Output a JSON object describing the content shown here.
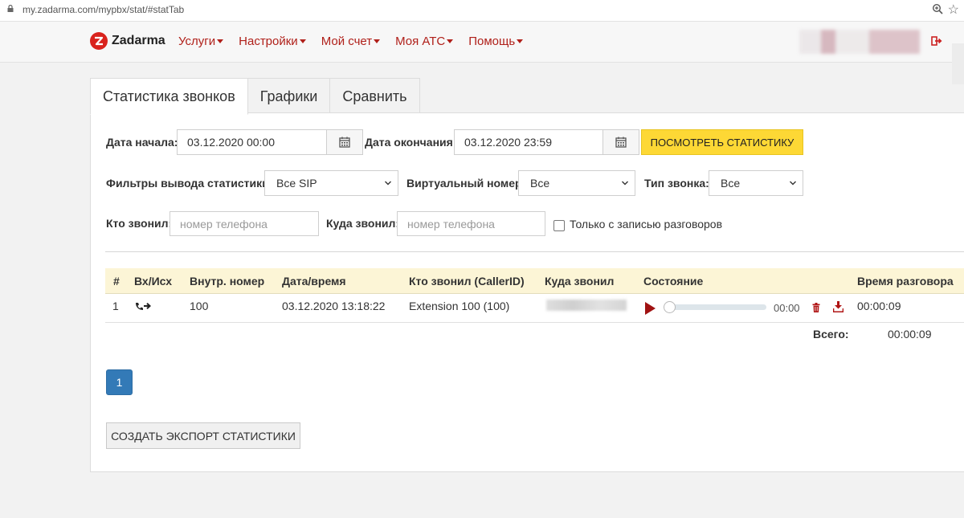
{
  "browser": {
    "url": "my.zadarma.com/mypbx/stat/#statTab"
  },
  "header": {
    "brand": "Zadarma",
    "menu": [
      {
        "label": "Услуги"
      },
      {
        "label": "Настройки"
      },
      {
        "label": "Мой счет"
      },
      {
        "label": "Моя АТС"
      },
      {
        "label": "Помощь"
      }
    ],
    "colors": {
      "brand_red": "#d9231d",
      "menu_red": "#b0201a"
    }
  },
  "tabs": [
    {
      "label": "Статистика звонков",
      "active": true
    },
    {
      "label": "Графики",
      "active": false
    },
    {
      "label": "Сравнить",
      "active": false
    }
  ],
  "filters": {
    "start_label": "Дата начала:",
    "start_value": "03.12.2020 00:00",
    "end_label": "Дата окончания:",
    "end_value": "03.12.2020 23:59",
    "submit_label": "Посмотреть статистику",
    "output_filter_label": "Фильтры вывода статистики:",
    "output_filter_value": "Все SIP",
    "virtual_number_label": "Виртуальный номер:",
    "virtual_number_value": "Все",
    "call_type_label": "Тип звонка:",
    "call_type_value": "Все",
    "caller_label": "Кто звонил:",
    "caller_placeholder": "номер телефона",
    "callee_label": "Куда звонил:",
    "callee_placeholder": "номер телефона",
    "recorded_only_label": "Только с записью разговоров",
    "recorded_only_checked": false
  },
  "table": {
    "columns": [
      "#",
      "Вх/Исх",
      "Внутр. номер",
      "Дата/время",
      "Кто звонил (CallerID)",
      "Куда звонил",
      "Состояние",
      "Время разговора"
    ],
    "rows": [
      {
        "num": "1",
        "direction_icon": "outgoing-call-icon",
        "extension": "100",
        "datetime": "03.12.2020 13:18:22",
        "caller_id": "Extension 100 (100)",
        "player_time": "00:00",
        "duration": "00:00:09"
      }
    ],
    "total_label": "Всего:",
    "total_value": "00:00:09"
  },
  "pagination": {
    "current": "1"
  },
  "export_label": "Создать экспорт статистики",
  "accent": {
    "yellow": "#fdd835",
    "header_row": "#fcf5d6",
    "page_blue": "#337ab7",
    "play_red": "#a01212"
  }
}
